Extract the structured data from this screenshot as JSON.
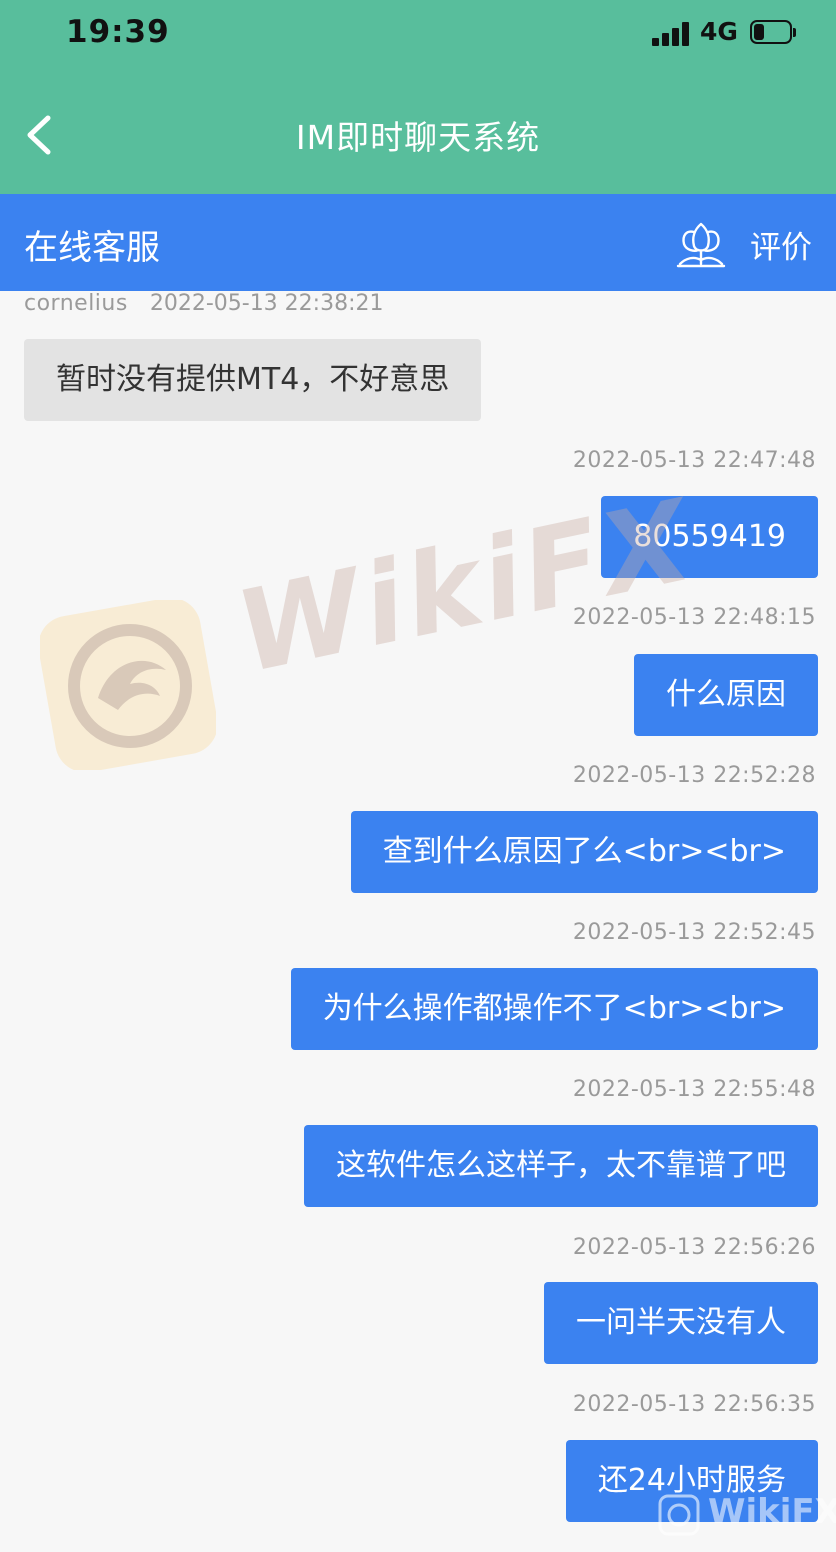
{
  "status_bar": {
    "time": "19:39",
    "network": "4G",
    "battery_level": 0.3
  },
  "nav": {
    "title": "IM即时聊天系统",
    "back_icon": "chevron-left-icon"
  },
  "header": {
    "service_title": "在线客服",
    "rate_label": "评价",
    "rate_icon": "flower-icon"
  },
  "colors": {
    "nav_bg": "#58be9c",
    "header_bg": "#3b82f0",
    "user_bubble": "#3b82f0",
    "agent_bubble": "#e3e3e3",
    "chat_bg": "#f7f7f7"
  },
  "chat": {
    "agent_message": {
      "sender": "cornelius",
      "time": "2022-05-13 22:38:21",
      "text": "暂时没有提供MT4，不好意思"
    },
    "user_messages": [
      {
        "time": "2022-05-13 22:47:48",
        "text": "80559419"
      },
      {
        "time": "2022-05-13 22:48:15",
        "text": "什么原因"
      },
      {
        "time": "2022-05-13 22:52:28",
        "text": "查到什么原因了么<br><br>"
      },
      {
        "time": "2022-05-13 22:52:45",
        "text": "为什么操作都操作不了<br><br>"
      },
      {
        "time": "2022-05-13 22:55:48",
        "text": "这软件怎么这样子，太不靠谱了吧"
      },
      {
        "time": "2022-05-13 22:56:26",
        "text": "一问半天没有人"
      },
      {
        "time": "2022-05-13 22:56:35",
        "text": "还24小时服务"
      }
    ]
  },
  "watermark": {
    "brand": "WikiFX"
  }
}
